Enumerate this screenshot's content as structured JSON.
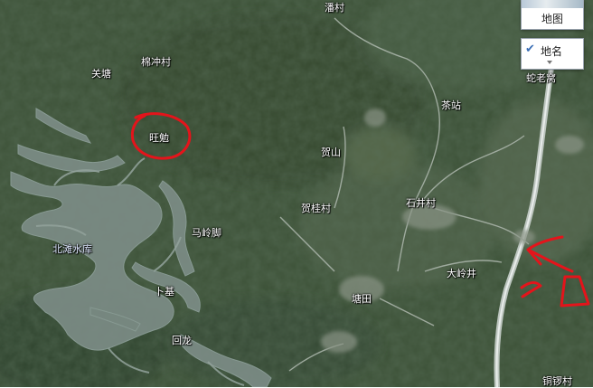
{
  "map_controls": {
    "map_type_label": "地图",
    "place_names_label": "地名",
    "place_names_checked": true
  },
  "places": {
    "pancun": "潘村",
    "mianchongcun": "棉冲村",
    "guantang": "关塘",
    "shelaowo": "蛇老窝",
    "chazhan": "茶站",
    "wangmian": "旺勉",
    "heshan": "贺山",
    "shijingcun": "石井村",
    "heguicun": "贺桂村",
    "malingjiao": "马岭脚",
    "beitanshuiku": "北滩水库",
    "dalingjing": "大岭井",
    "buji": "卜基",
    "tangtian": "塘田",
    "huilong": "回龙",
    "tongluocun": "铜锣村"
  },
  "annotation_color": "#e4141b"
}
